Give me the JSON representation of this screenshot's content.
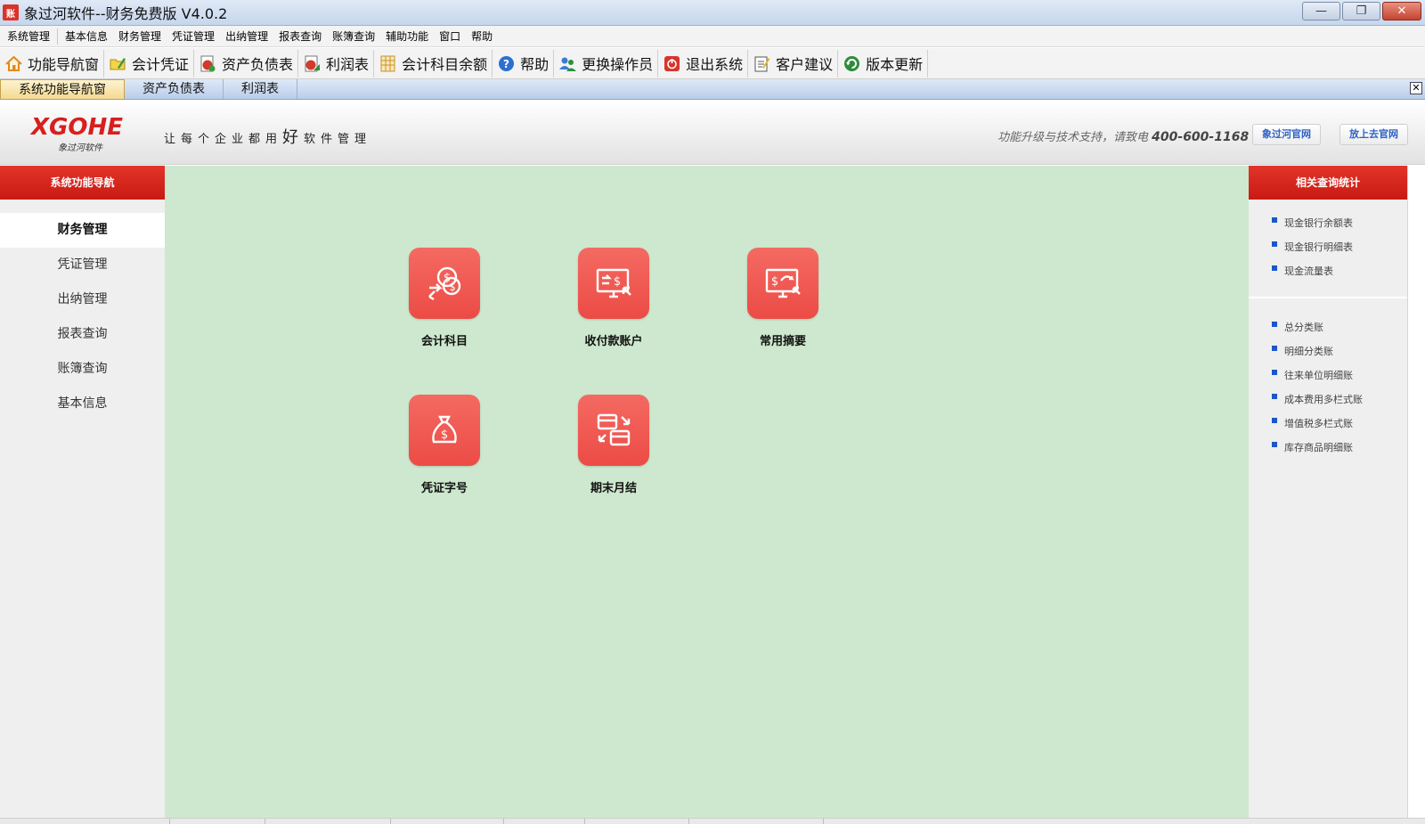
{
  "window": {
    "app_icon_glyph": "账",
    "title": "象过河软件--财务免费版 V4.0.2",
    "minimize": "—",
    "restore": "❐",
    "close": "✕"
  },
  "menu": [
    "系统管理",
    "基本信息",
    "财务管理",
    "凭证管理",
    "出纳管理",
    "报表查询",
    "账簿查询",
    "辅助功能",
    "窗口",
    "帮助"
  ],
  "toolbar": [
    {
      "label": "功能导航窗",
      "icon": "home-icon",
      "color": "#e08a1e"
    },
    {
      "label": "会计凭证",
      "icon": "folder-pen-icon",
      "color": "#d8b325"
    },
    {
      "label": "资产负债表",
      "icon": "sheet-icon",
      "color": "#c33b2d"
    },
    {
      "label": "利润表",
      "icon": "profit-icon",
      "color": "#2f8f3a"
    },
    {
      "label": "会计科目余额",
      "icon": "ledger-icon",
      "color": "#c9902a"
    },
    {
      "label": "帮助",
      "icon": "help-icon",
      "color": "#2d6fd0"
    },
    {
      "label": "更换操作员",
      "icon": "users-icon",
      "color": "#3a7bd5"
    },
    {
      "label": "退出系统",
      "icon": "power-icon",
      "color": "#d9342b"
    },
    {
      "label": "客户建议",
      "icon": "note-icon",
      "color": "#555555"
    },
    {
      "label": "版本更新",
      "icon": "update-icon",
      "color": "#2e8b3c"
    }
  ],
  "tabs": [
    "系统功能导航窗",
    "资产负债表",
    "利润表"
  ],
  "tab_close": "✕",
  "banner": {
    "logo": "XGOHE",
    "logo_sub": "象过河软件",
    "slogan_pre": "让每个企业都用",
    "slogan_em": "好",
    "slogan_post": "软件管理",
    "support_text": "功能升级与技术支持，请致电",
    "support_phone": "400-600-1168",
    "btn_official": "象过河官网",
    "btn_go": "放上去官网"
  },
  "left_panel": {
    "title": "系统功能导航",
    "items": [
      "财务管理",
      "凭证管理",
      "出纳管理",
      "报表查询",
      "账簿查询",
      "基本信息"
    ]
  },
  "tiles": [
    "会计科目",
    "收付款账户",
    "常用摘要",
    "凭证字号",
    "期末月结"
  ],
  "right_panel": {
    "title": "相关查询统计",
    "group1": [
      "现金银行余额表",
      "现金银行明细表",
      "现金流量表"
    ],
    "group2": [
      "总分类账",
      "明细分类账",
      "往来单位明细账",
      "成本费用多栏式账",
      "增值税多栏式账",
      "库存商品明细账"
    ]
  },
  "colors": {
    "accent_red": "#d9342b",
    "tile_red": "#ef5450",
    "main_bg": "#cde8ce",
    "link_blue": "#1a57c7"
  }
}
